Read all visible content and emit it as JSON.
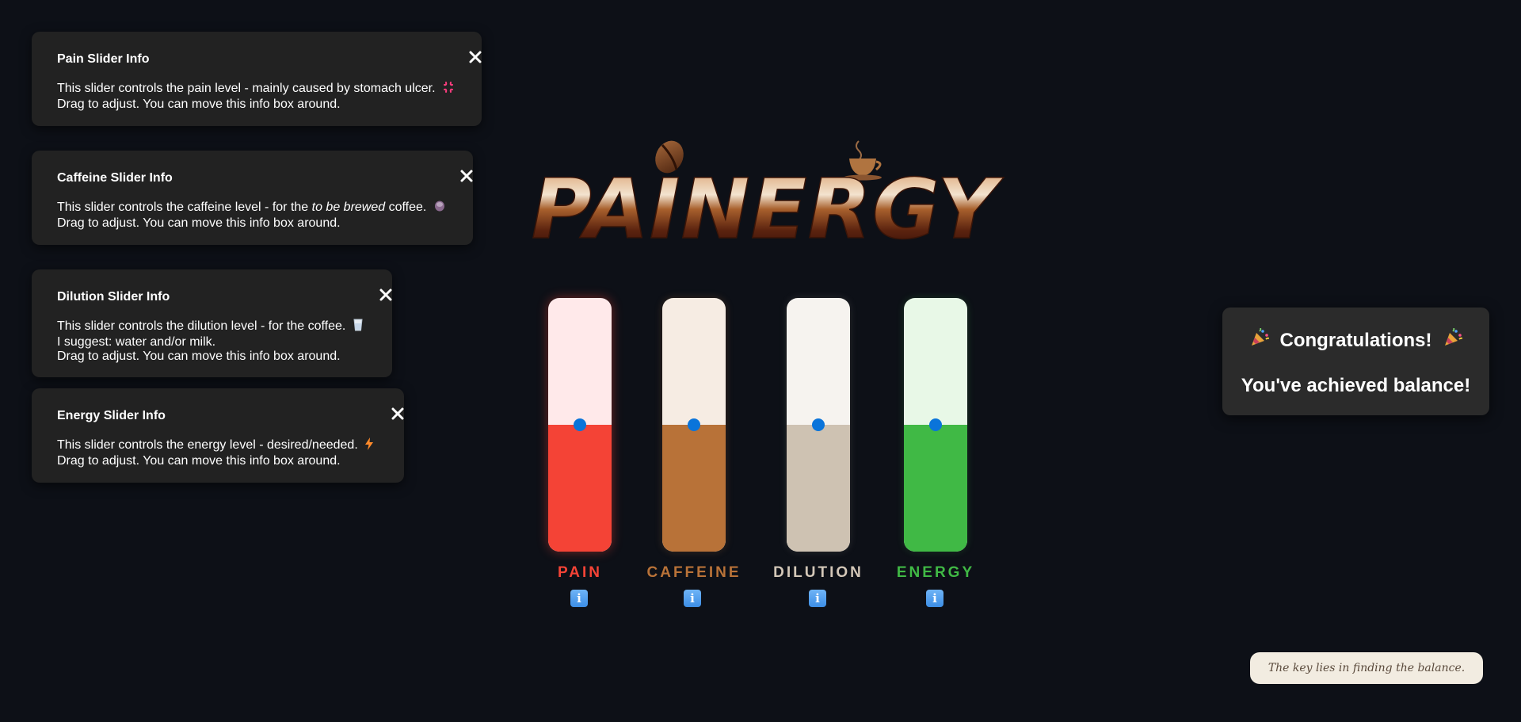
{
  "info_boxes": {
    "pain": {
      "title": "Pain Slider Info",
      "line1": "This slider controls the pain level - mainly caused by stomach ulcer.",
      "line2": "Drag to adjust. You can move this info box around.",
      "emoji_icon": "anger-symbol-icon"
    },
    "caffeine": {
      "title": "Caffeine Slider Info",
      "line1_before": "This slider controls the caffeine level - for the ",
      "line1_emphasis": "to be brewed",
      "line1_after": " coffee.",
      "line2": "Drag to adjust. You can move this info box around.",
      "emoji_icon": "coffee-bean-icon"
    },
    "dilution": {
      "title": "Dilution Slider Info",
      "line1": "This slider controls the dilution level - for the coffee.",
      "line2": "I suggest: water and/or milk.",
      "line3": "Drag to adjust. You can move this info box around.",
      "emoji_icon": "glass-icon"
    },
    "energy": {
      "title": "Energy Slider Info",
      "line1": "This slider controls the energy level - desired/needed.",
      "line2": "Drag to adjust. You can move this info box around.",
      "emoji_icon": "lightning-icon"
    }
  },
  "logo": {
    "text": "PAINERGY"
  },
  "sliders": [
    {
      "key": "pain",
      "label": "PAIN",
      "level_percent": 50,
      "label_color": "#f44336",
      "fill_color": "#f44336",
      "track_color": "#ffe9ea"
    },
    {
      "key": "caffeine",
      "label": "CAFFEINE",
      "level_percent": 50,
      "label_color": "#b87238",
      "fill_color": "#b87238",
      "track_color": "#f6ece3"
    },
    {
      "key": "dilution",
      "label": "DILUTION",
      "level_percent": 50,
      "label_color": "#d3c7b8",
      "fill_color": "#cec2b2",
      "track_color": "#f6f3ef"
    },
    {
      "key": "energy",
      "label": "ENERGY",
      "level_percent": 50,
      "label_color": "#40b945",
      "fill_color": "#40b945",
      "track_color": "#e8f8e7"
    }
  ],
  "info_button": {
    "glyph": "i",
    "icon": "information-icon"
  },
  "congrats": {
    "icon": "party-popper-icon",
    "title": "Congratulations!",
    "subtitle": "You've achieved balance!"
  },
  "hint": {
    "text": "The key lies in finding the balance."
  },
  "colors": {
    "background": "#0d1017",
    "panel": "#222222",
    "thumb": "#0a74da"
  }
}
